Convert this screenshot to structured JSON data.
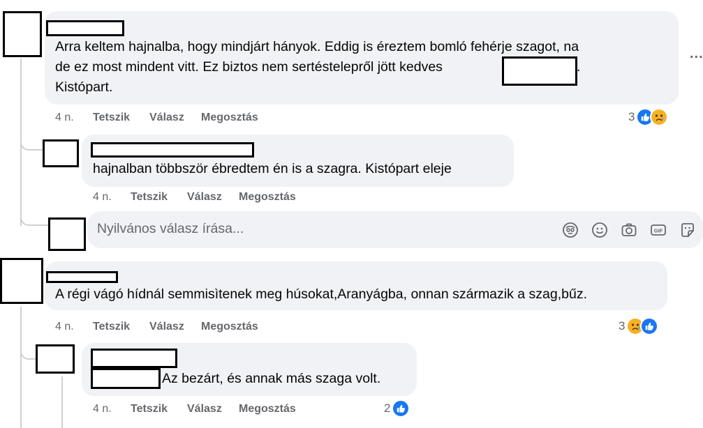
{
  "comments": [
    {
      "text_line1": "Arra keltem hajnalba, hogy mindjárt hányok. Eddig is éreztem bomló fehérje szagot, na",
      "text_line2": "de ez most mindent vitt. Ez biztos nem sertéstelepről jött kedves",
      "text_line2_suffix": ".",
      "text_line3": "Kistópart.",
      "time": "4 n.",
      "like": "Tetszik",
      "reply": "Válasz",
      "share": "Megosztás",
      "reaction_count": "3",
      "reactions": [
        "like-icon",
        "sad-icon"
      ]
    },
    {
      "text": "hajnalban többször ébredtem én is a szagra. Kistópart eleje",
      "time": "4 n.",
      "like": "Tetszik",
      "reply": "Válasz",
      "share": "Megosztás"
    },
    {
      "text": "A régi vágó hídnál semmisìtenek meg húsokat,Aranyágba, onnan származik a szag,bűz.",
      "time": "4 n.",
      "like": "Tetszik",
      "reply": "Válasz",
      "share": "Megosztás",
      "reaction_count": "3",
      "reactions": [
        "sad-icon",
        "like-icon"
      ]
    },
    {
      "text": "Az bezárt, és annak más szaga volt.",
      "time": "4 n.",
      "like": "Tetszik",
      "reply": "Válasz",
      "share": "Megosztás",
      "reaction_count": "2",
      "reactions": [
        "like-icon"
      ]
    }
  ],
  "reply_box": {
    "placeholder": "Nyilvános válasz írása...",
    "tools": [
      "avatar-sticker-icon",
      "emoji-icon",
      "camera-icon",
      "gif-icon",
      "sticker-icon"
    ]
  },
  "more_menu": "..."
}
